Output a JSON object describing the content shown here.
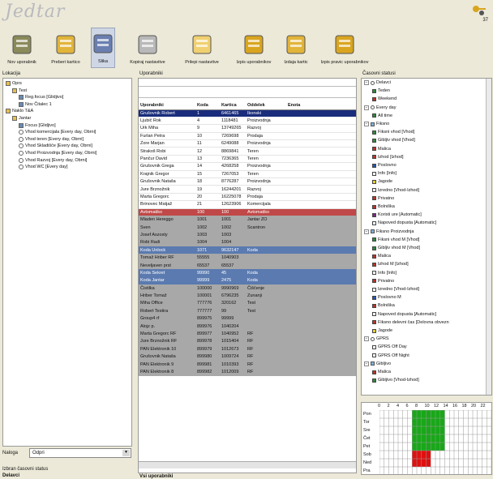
{
  "app": {
    "logo": "Jedtar",
    "version": "37"
  },
  "toolbar": [
    {
      "id": "new-user",
      "label": "Nov uporabnik",
      "icon": "user-add-icon"
    },
    {
      "id": "move-card",
      "label": "Preberi kartico",
      "icon": "card-reader-icon"
    },
    {
      "id": "image",
      "label": "Slika",
      "icon": "image-icon"
    },
    {
      "id": "copy-settings",
      "label": "Kopiraj nastavitve",
      "icon": "copy-settings-icon"
    },
    {
      "id": "paste-settings",
      "label": "Prilepi nastavitve",
      "icon": "paste-settings-icon"
    },
    {
      "id": "delete-users",
      "label": "Izpis uporabnikov",
      "icon": "users-icon"
    },
    {
      "id": "delete-card",
      "label": "Izdaja kartic",
      "icon": "card-issue-icon"
    },
    {
      "id": "delete-rights",
      "label": "Izpis pravic uporabnikov",
      "icon": "rights-icon"
    }
  ],
  "location": {
    "title": "Lokacija",
    "filter_label": "Naloga",
    "filter_value": "Odpri",
    "selected_status_label": "Izbran časovni status",
    "selected_status_value": "Delavci",
    "tree": [
      {
        "l": "Oprs",
        "d": 0,
        "i": "folder"
      },
      {
        "l": "Test",
        "d": 1,
        "i": "folder"
      },
      {
        "l": "Reg.focus [Glidjivo]",
        "d": 2,
        "i": "device"
      },
      {
        "l": "Nov Čitalec 1",
        "d": 2,
        "i": "reader"
      },
      {
        "l": "Naklo T&A",
        "d": 0,
        "i": "folder"
      },
      {
        "l": "Jantar",
        "d": 1,
        "i": "folder"
      },
      {
        "l": "Focus [Glidjivo]",
        "d": 2,
        "i": "device"
      },
      {
        "l": "Vhod komercijala [Every day, Obrni]",
        "d": 2,
        "i": "clock"
      },
      {
        "l": "Vhod teren [Every day, Obrni]",
        "d": 2,
        "i": "clock"
      },
      {
        "l": "Vhod Skladišče [Every day, Obrni]",
        "d": 2,
        "i": "clock"
      },
      {
        "l": "Vhod Proizvodnja [Every day, Obrni]",
        "d": 2,
        "i": "clock"
      },
      {
        "l": "Vhod Razvoj [Every day, Obrni]",
        "d": 2,
        "i": "clock"
      },
      {
        "l": "Vhod WC [Every day]",
        "d": 2,
        "i": "clock"
      }
    ]
  },
  "users": {
    "title": "Uporabniki",
    "footer": "Vsi uporabniki",
    "columns": [
      "Uporabniki",
      "Koda",
      "Kartica",
      "Oddelek",
      "Enota"
    ],
    "rows": [
      [
        "Grušovnik Robert",
        "1",
        "6461465",
        "Ikonski",
        "",
        "sel"
      ],
      [
        "Ljubič Rok",
        "4",
        "1118481",
        "Proizvodnja",
        "",
        ""
      ],
      [
        "Urk Miha",
        "9",
        "13749265",
        "Razvoj",
        "",
        ""
      ],
      [
        "Furlan Petra",
        "10",
        "7269698",
        "Prodaja",
        "",
        ""
      ],
      [
        "Zore Marjan",
        "11",
        "6249088",
        "Proizvodnja",
        "",
        ""
      ],
      [
        "Strakoš Robi",
        "12",
        "8869841",
        "Teren",
        "",
        ""
      ],
      [
        "Pančur David",
        "13",
        "7236365",
        "Teren",
        "",
        ""
      ],
      [
        "Grušovnik Grega",
        "14",
        "4268258",
        "Proizvodnja",
        "",
        ""
      ],
      [
        "Krajnik Gregor",
        "15",
        "7267053",
        "Teren",
        "",
        ""
      ],
      [
        "Grušovnik Nataša",
        "18",
        "8776287",
        "Proizvodnja",
        "",
        ""
      ],
      [
        "Jure Brznožnik",
        "19",
        "16244201",
        "Razvoj",
        "",
        ""
      ],
      [
        "Marta Gregorc",
        "20",
        "16225078",
        "Prodaja",
        "",
        ""
      ],
      [
        "Brinovec Matjaž",
        "21",
        "12623906",
        "Komercijala",
        "",
        ""
      ],
      [
        "Avtomatiko",
        "100",
        "100",
        "Avtomatiko",
        "",
        "red"
      ],
      [
        "Mladen Hereggo",
        "1001",
        "1001",
        "Jantar ZO",
        "",
        "gray"
      ],
      [
        "Sven",
        "1002",
        "1002",
        "Scantron",
        "",
        "gray"
      ],
      [
        "Josef Aszosty",
        "1003",
        "1003",
        "",
        "",
        "gray"
      ],
      [
        "Robi Radi",
        "1004",
        "1004",
        "",
        "",
        "gray"
      ],
      [
        "Koda Unlock",
        "1071",
        "9632147",
        "Koda",
        "",
        "blue"
      ],
      [
        "Tomaž Hriber RF",
        "55555",
        "1040903",
        "",
        "",
        "gray"
      ],
      [
        "Neveljaven prst",
        "65537",
        "65537",
        "",
        "",
        "gray"
      ],
      [
        "Koda Sekret",
        "99990",
        "45",
        "Koda",
        "",
        "blue"
      ],
      [
        "Koda Jantar",
        "99999",
        "2475",
        "Koda",
        "",
        "blue"
      ],
      [
        "Čistilka",
        "100000",
        "9990969",
        "Čiščenje",
        "",
        "gray"
      ],
      [
        "Hriber Tomaž",
        "100001",
        "6796235",
        "Zunanji",
        "",
        "gray"
      ],
      [
        "Miha Office",
        "777776",
        "320162",
        "Test",
        "",
        "gray"
      ],
      [
        "Robert Testira",
        "777777",
        "99",
        "Test",
        "",
        "gray"
      ],
      [
        "Group4 rf",
        "899975",
        "99999",
        "",
        "",
        "gray"
      ],
      [
        "Alojz p.",
        "899976",
        "1040204",
        "",
        "",
        "gray"
      ],
      [
        "Marta Gregorc RF",
        "899977",
        "1040952",
        "RF",
        "",
        "gray"
      ],
      [
        "Jure Brznožnik RF",
        "899978",
        "1015404",
        "RF",
        "",
        "gray"
      ],
      [
        "PAN Elektronik 10",
        "899979",
        "1012673",
        "RF",
        "",
        "gray"
      ],
      [
        "Grušovnik Nataša",
        "899980",
        "1009724",
        "RF",
        "",
        "gray"
      ],
      [
        "PAN Elektronik 9",
        "899981",
        "1010393",
        "RF",
        "",
        "gray"
      ],
      [
        "PAN Elektronik 8",
        "899982",
        "1012009",
        "RF",
        "",
        "gray"
      ]
    ]
  },
  "statuses": {
    "title": "Časovni statusi",
    "items": [
      {
        "l": "Delavci",
        "d": 0,
        "i": "clock"
      },
      {
        "l": "Teden",
        "d": 1,
        "c": "#2e8b3a"
      },
      {
        "l": "Weekend",
        "d": 1,
        "c": "#c0302c"
      },
      {
        "l": "Every day",
        "d": 0,
        "i": "clock"
      },
      {
        "l": "All time",
        "d": 1,
        "c": "#2e8b3a"
      },
      {
        "l": "Fiksno",
        "d": 0,
        "i": "group"
      },
      {
        "l": "Fiksni vhod [Vhod]",
        "d": 1,
        "c": "#2e8b3a"
      },
      {
        "l": "Gibljiv vhod [Vhod]",
        "d": 1,
        "c": "#2e8b3a"
      },
      {
        "l": "Malica",
        "d": 1,
        "c": "#c0302c"
      },
      {
        "l": "Izhod [Izhod]",
        "d": 1,
        "c": "#c0302c"
      },
      {
        "l": "Poslovno",
        "d": 1,
        "c": "#2555b8"
      },
      {
        "l": "Info [Info]",
        "d": 1,
        "c": "#ffffff"
      },
      {
        "l": "Jagode",
        "d": 1,
        "c": "#e8d42a"
      },
      {
        "l": "Izredno [Vhod-Izhod]",
        "d": 1,
        "c": "#ffffff"
      },
      {
        "l": "Privatno",
        "d": 1,
        "c": "#c0302c"
      },
      {
        "l": "Bolniška",
        "d": 1,
        "c": "#c0302c"
      },
      {
        "l": "Koristi ure [Automatic]",
        "d": 1,
        "c": "#7a2a8a"
      },
      {
        "l": "Napoved dopusta [Automatic]",
        "d": 1,
        "c": "#ffffff"
      },
      {
        "l": "Fiksno Proizvodnja",
        "d": 0,
        "i": "group"
      },
      {
        "l": "Fiksni vhod M [Vhod]",
        "d": 1,
        "c": "#2e8b3a"
      },
      {
        "l": "Gibljiv vhod M [Vhod]",
        "d": 1,
        "c": "#2e8b3a"
      },
      {
        "l": "Malica",
        "d": 1,
        "c": "#c0302c"
      },
      {
        "l": "Izhod M [Izhod]",
        "d": 1,
        "c": "#c0302c"
      },
      {
        "l": "Info [Info]",
        "d": 1,
        "c": "#ffffff"
      },
      {
        "l": "Privatno",
        "d": 1,
        "c": "#c0302c"
      },
      {
        "l": "Izredno [Vhod-Izhod]",
        "d": 1,
        "c": "#ffffff"
      },
      {
        "l": "Poslovno M",
        "d": 1,
        "c": "#2555b8"
      },
      {
        "l": "Bolniška",
        "d": 1,
        "c": "#c0302c"
      },
      {
        "l": "Napoved dopusta [Automatic]",
        "d": 1,
        "c": "#ffffff"
      },
      {
        "l": "Fiksno delevni čas [Delovna obvezn",
        "d": 1,
        "c": "#c0302c"
      },
      {
        "l": "Jagode",
        "d": 1,
        "c": "#e8d42a"
      },
      {
        "l": "GPRS",
        "d": 0,
        "i": "clock"
      },
      {
        "l": "GPRS Off Day",
        "d": 1,
        "c": "#ffffff"
      },
      {
        "l": "GPRS Off Night",
        "d": 1,
        "c": "#ffffff"
      },
      {
        "l": "Gibljivo",
        "d": 0,
        "i": "group"
      },
      {
        "l": "Malica",
        "d": 1,
        "c": "#c0302c"
      },
      {
        "l": "Gibljivo [Vhod-Izhod]",
        "d": 1,
        "c": "#2e8b3a"
      }
    ]
  },
  "calendar": {
    "hours": [
      "0",
      "2",
      "4",
      "6",
      "8",
      "10",
      "12",
      "14",
      "16",
      "18",
      "20",
      "22"
    ],
    "days": [
      "Pon",
      "Tor",
      "Sre",
      "Čet",
      "Pet",
      "Sob",
      "Ned",
      "Pra"
    ],
    "blocks": [
      {
        "rows": [
          0,
          5
        ],
        "from": 7,
        "to": 14,
        "color": "#18a818"
      },
      {
        "rows": [
          5,
          7
        ],
        "from": 7,
        "to": 11,
        "color": "#e01010"
      }
    ]
  }
}
